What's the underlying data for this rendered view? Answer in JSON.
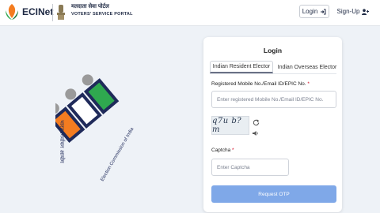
{
  "header": {
    "brand": "ECINet",
    "portal_hindi": "मतदाता सेवा पोर्टल",
    "portal_english": "VOTERS' SERVICE PORTAL",
    "login_label": "Login",
    "signup_label": "Sign-Up",
    "icons": {
      "login": "login-arrow-icon",
      "signup": "user-plus-icon"
    }
  },
  "eci_logo": {
    "hindi_text": "भारत निर्वाचन आयोग",
    "english_text": "Election Commission of India",
    "colors": {
      "saffron": "#f47c20",
      "navy": "#1f2a5a",
      "green": "#2fa84f",
      "grey": "#9a9a9a"
    }
  },
  "login": {
    "title": "Login",
    "tabs": [
      "Indian Resident Elector",
      "Indian Overseas Elector"
    ],
    "active_tab": 0,
    "id_label": "Registered Mobile No./Email ID/EPIC No.",
    "id_placeholder": "Enter registered Mobile No./Email ID/EPIC No.",
    "id_value": "",
    "captcha_text": "q7u b?m",
    "captcha_label": "Captcha",
    "captcha_placeholder": "Enter Captcha",
    "captcha_value": "",
    "required_mark": "*",
    "submit_label": "Request OTP",
    "colors": {
      "button": "#7fa8e8",
      "required": "#d0021b"
    }
  }
}
